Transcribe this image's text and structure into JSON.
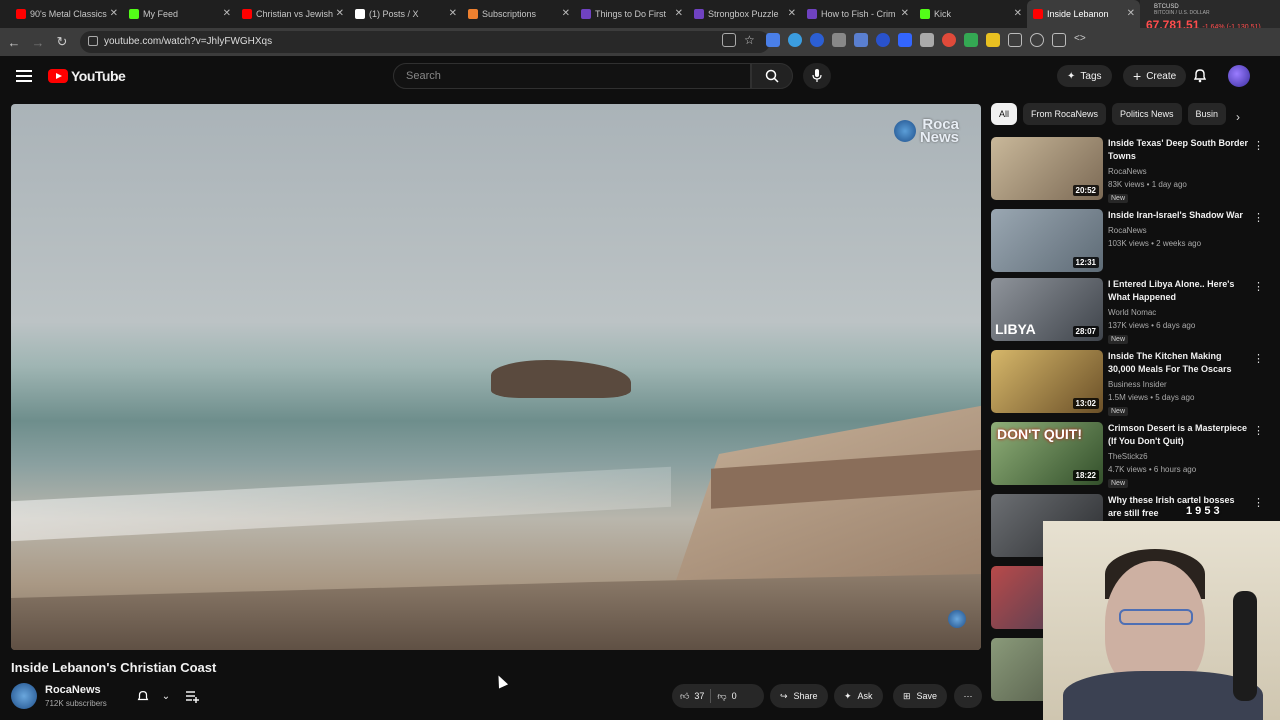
{
  "browser": {
    "tabs": [
      {
        "label": "90's Metal Classics",
        "color": "#ff0000"
      },
      {
        "label": "My Feed",
        "color": "#53fc18"
      },
      {
        "label": "Christian vs Jewish",
        "color": "#ff0000"
      },
      {
        "label": "(1) Posts / X",
        "color": "#ffffff"
      },
      {
        "label": "Subscriptions",
        "color": "#ee802f"
      },
      {
        "label": "Things to Do First",
        "color": "#6f42c1"
      },
      {
        "label": "Strongbox Puzzle",
        "color": "#6f42c1"
      },
      {
        "label": "How to Fish - Crim",
        "color": "#6f42c1"
      },
      {
        "label": "Kick",
        "color": "#53fc18"
      },
      {
        "label": "Inside Lebanon",
        "color": "#ff0000"
      }
    ],
    "url": "youtube.com/watch?v=JhlyFWGHXqs",
    "ticker": {
      "symbol": "BTCUSD",
      "name": "BITCOIN / U.S. DOLLAR",
      "price": "67,781.51",
      "change": "-1.64% (-1,130.51)"
    }
  },
  "youtube": {
    "logo": "YouTube",
    "search_placeholder": "Search",
    "tags_label": "Tags",
    "create_label": "Create"
  },
  "video": {
    "watermark_line1": "Roca",
    "watermark_line2": "News",
    "title": "Inside Lebanon's Christian Coast",
    "channel": "RocaNews",
    "subscribers": "712K subscribers",
    "likes": "37",
    "dislikes": "0",
    "share_label": "Share",
    "ask_label": "Ask",
    "save_label": "Save"
  },
  "sidebar": {
    "chips": [
      "All",
      "From RocaNews",
      "Politics News",
      "Busin"
    ],
    "items": [
      {
        "title": "Inside Texas' Deep South Border Towns",
        "channel": "RocaNews",
        "meta": "83K views • 1 day ago",
        "new": "New",
        "duration": "20:52",
        "thumb": "#7c6a55",
        "overlay": ""
      },
      {
        "title": "Inside Iran-Israel's Shadow War",
        "channel": "RocaNews",
        "meta": "103K views • 2 weeks ago",
        "new": "",
        "duration": "12:31",
        "thumb": "#6d7a86",
        "overlay": ""
      },
      {
        "title": "I Entered Libya Alone.. Here's What Happened",
        "channel": "World Nomac",
        "meta": "137K views • 6 days ago",
        "new": "New",
        "duration": "28:07",
        "thumb": "#555a62",
        "overlay": "LIBYA"
      },
      {
        "title": "Inside The Kitchen Making 30,000 Meals For The Oscars",
        "channel": "Business Insider",
        "meta": "1.5M views • 5 days ago",
        "new": "New",
        "duration": "13:02",
        "thumb": "#9a7a3a",
        "overlay": ""
      },
      {
        "title": "Crimson Desert is a Masterpiece (If You Don't Quit)",
        "channel": "TheStickz6",
        "meta": "4.7K views • 6 hours ago",
        "new": "New",
        "duration": "18:22",
        "thumb": "#4d6a44",
        "overlay": "DON'T QUIT!"
      },
      {
        "title": "Why these Irish cartel bosses are still free",
        "channel": "",
        "meta": "",
        "new": "",
        "duration": "",
        "thumb": "#3b3f44",
        "overlay": ""
      }
    ]
  },
  "stream_overlay": "1 9 5 3"
}
